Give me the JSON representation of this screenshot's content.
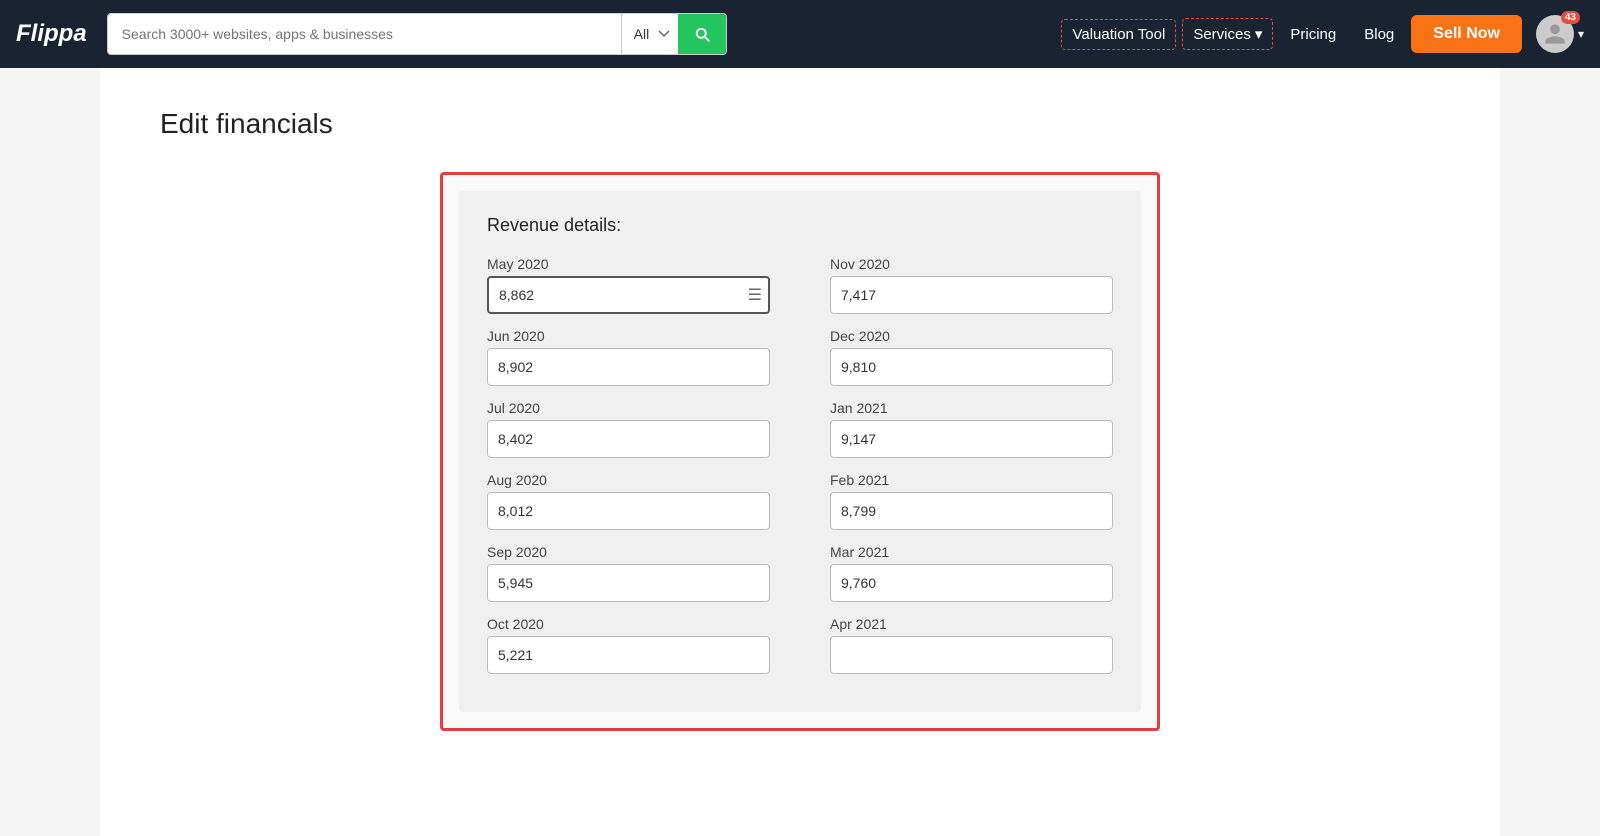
{
  "navbar": {
    "logo": "Flippa",
    "search_placeholder": "Search 3000+ websites, apps & businesses",
    "search_category": "All",
    "valuation_tool": "Valuation Tool",
    "services": "Services",
    "pricing": "Pricing",
    "blog": "Blog",
    "sell_now": "Sell Now",
    "notification_count": "43"
  },
  "page": {
    "title": "Edit financials"
  },
  "revenue": {
    "section_title": "Revenue details:",
    "fields": [
      {
        "label": "May 2020",
        "value": "8,862",
        "col": "left",
        "active": true
      },
      {
        "label": "Nov 2020",
        "value": "7,417",
        "col": "right"
      },
      {
        "label": "Jun 2020",
        "value": "8,902",
        "col": "left"
      },
      {
        "label": "Dec 2020",
        "value": "9,810",
        "col": "right"
      },
      {
        "label": "Jul 2020",
        "value": "8,402",
        "col": "left"
      },
      {
        "label": "Jan 2021",
        "value": "9,147",
        "col": "right"
      },
      {
        "label": "Aug 2020",
        "value": "8,012",
        "col": "left"
      },
      {
        "label": "Feb 2021",
        "value": "8,799",
        "col": "right"
      },
      {
        "label": "Sep 2020",
        "value": "5,945",
        "col": "left"
      },
      {
        "label": "Mar 2021",
        "value": "9,760",
        "col": "right"
      },
      {
        "label": "Oct 2020",
        "value": "5,221",
        "col": "left"
      },
      {
        "label": "Apr 2021",
        "value": "",
        "col": "right"
      }
    ]
  }
}
